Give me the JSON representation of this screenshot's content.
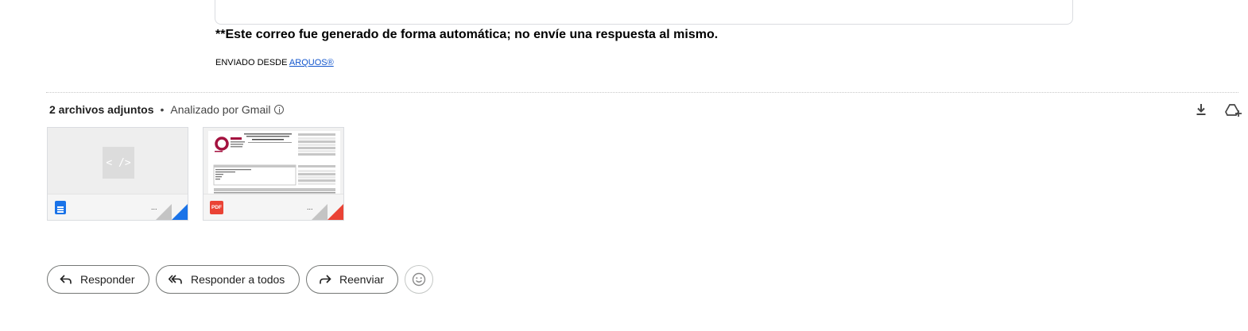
{
  "message": {
    "notice": "**Este correo fue generado de forma automática; no envíe una respuesta al mismo.",
    "sent_from_prefix": "ENVIADO DESDE ",
    "sent_from_link": "ARQUOS®"
  },
  "attachments": {
    "count_label": "2 archivos adjuntos",
    "separator": "•",
    "scanned_label": "Analizado por Gmail",
    "items": [
      {
        "type": "document",
        "preview_glyph": "< />",
        "name": "..."
      },
      {
        "type": "pdf",
        "badge": "PDF",
        "name": "..."
      }
    ],
    "colors": {
      "document": "#1a73e8",
      "pdf": "#ea4335"
    }
  },
  "actions": {
    "reply": "Responder",
    "reply_all": "Responder a todos",
    "forward": "Reenviar"
  },
  "icons": {
    "download": "download-icon",
    "save_to_drive": "add-to-drive-icon",
    "reply": "reply-arrow-icon",
    "reply_all": "reply-all-arrow-icon",
    "forward": "forward-arrow-icon",
    "emoji": "emoji-smile-icon"
  }
}
